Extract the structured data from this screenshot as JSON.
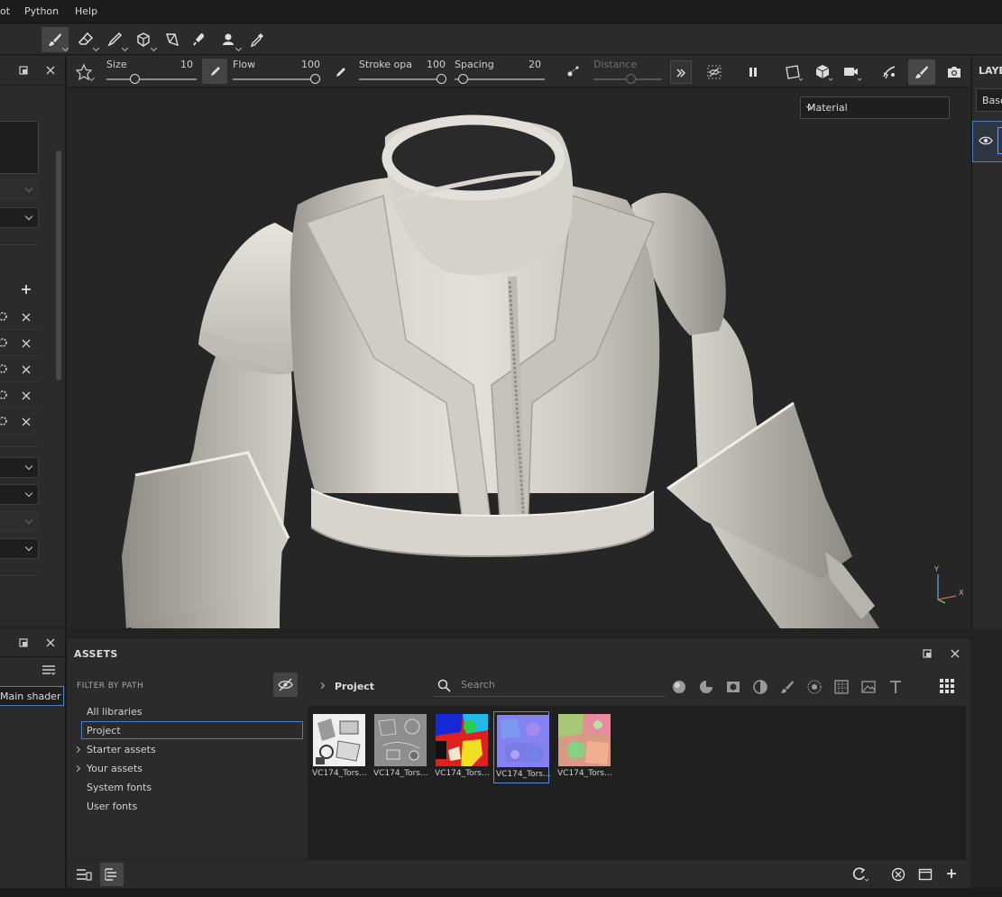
{
  "menu": {
    "items": [
      "ot",
      "Python",
      "Help"
    ]
  },
  "properties": {
    "size_label": "Size",
    "size_value": "10",
    "flow_label": "Flow",
    "flow_value": "100",
    "stroke_label": "Stroke opa",
    "stroke_value": "100",
    "spacing_label": "Spacing",
    "spacing_value": "20",
    "distance_label": "Distance"
  },
  "viewport": {
    "channel_select": "Material",
    "axis_y": "Y",
    "axis_x": "X"
  },
  "layers": {
    "title": "LAYE",
    "channel": "Base"
  },
  "left_lower": {
    "shader_field": "Main shader"
  },
  "assets": {
    "title": "ASSETS",
    "filter_label": "FILTER BY PATH",
    "libraries": [
      {
        "label": "All libraries",
        "expandable": false
      },
      {
        "label": "Project",
        "expandable": false,
        "selected": true
      },
      {
        "label": "Starter assets",
        "expandable": true
      },
      {
        "label": "Your assets",
        "expandable": true
      },
      {
        "label": "System fonts",
        "expandable": false
      },
      {
        "label": "User fonts",
        "expandable": false
      }
    ],
    "breadcrumb": "Project",
    "search_placeholder": "Search",
    "thumbnails": [
      {
        "caption": "VC174_Tors..."
      },
      {
        "caption": "VC174_Tors..."
      },
      {
        "caption": "VC174_Tors..."
      },
      {
        "caption": "VC174_Tors...",
        "selected": true
      },
      {
        "caption": "VC174_Tors..."
      }
    ]
  },
  "colors": {
    "accent": "#4a7fc4",
    "panel": "#2b2b2b",
    "viewport": "#262626",
    "model": "#d8d6cf"
  }
}
